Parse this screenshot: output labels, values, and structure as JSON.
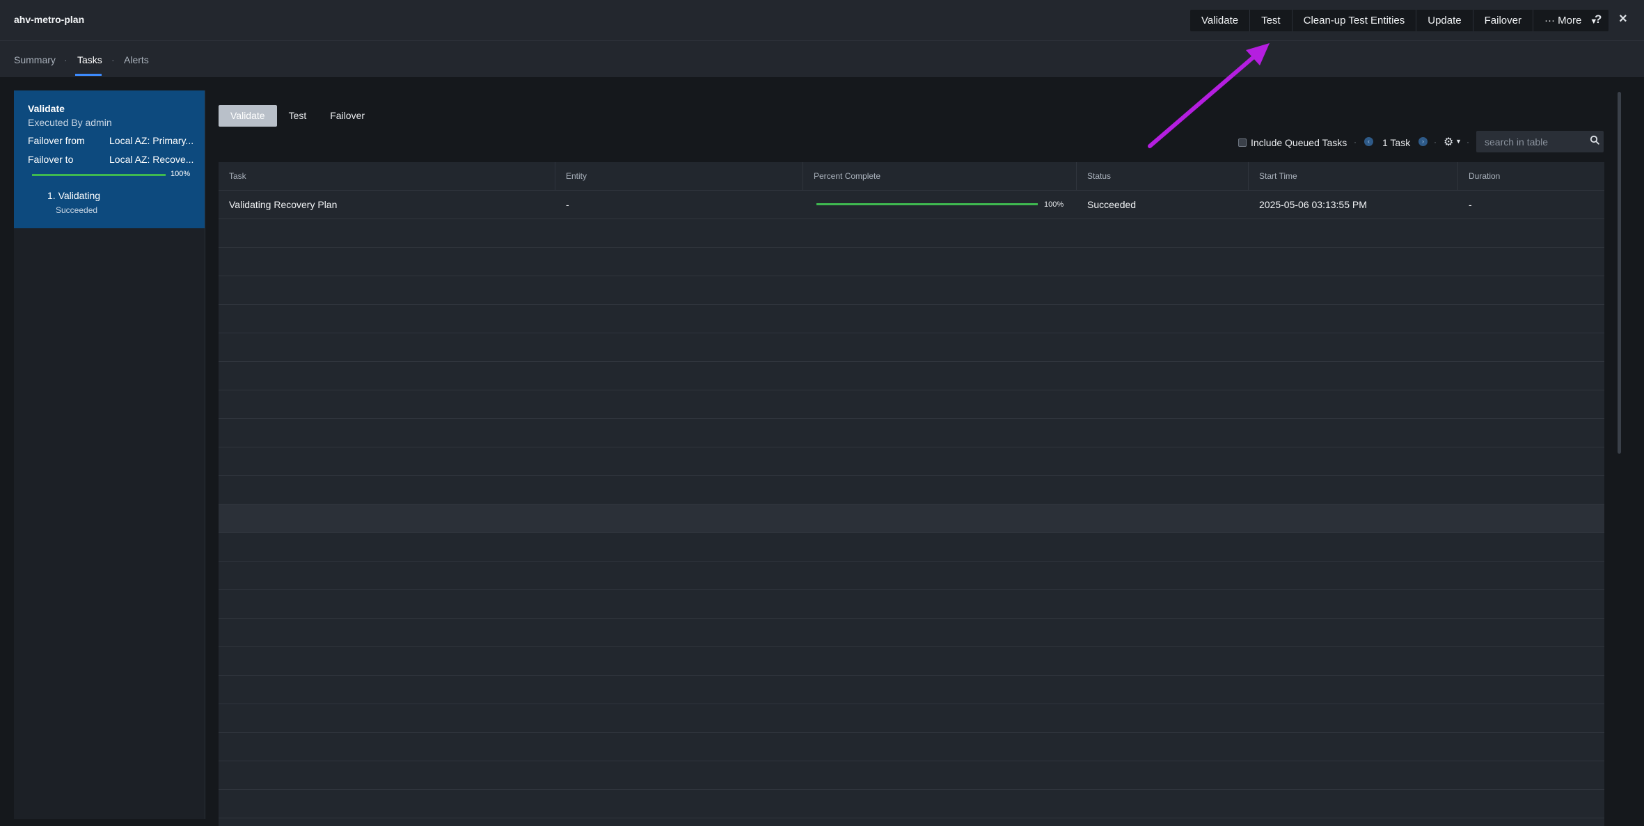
{
  "header": {
    "title": "ahv-metro-plan",
    "actions": [
      "Validate",
      "Test",
      "Clean-up Test Entities",
      "Update",
      "Failover",
      "··· More"
    ],
    "help": "?",
    "close": "×"
  },
  "tabs": [
    {
      "label": "Summary"
    },
    {
      "label": "Tasks",
      "active": true
    },
    {
      "label": "Alerts"
    }
  ],
  "plan": {
    "title": "Validate",
    "executed_by": "Executed By admin",
    "failover_from_label": "Failover from",
    "failover_from_value": "Local AZ: Primary...",
    "failover_to_label": "Failover to",
    "failover_to_value": "Local AZ: Recove...",
    "progress": 1.0,
    "progress_label": "100%",
    "step_label": "1. Validating",
    "step_status": "Succeeded"
  },
  "filters": {
    "tabs": [
      "Validate",
      "Test",
      "Failover"
    ],
    "active": "Validate"
  },
  "toolbar": {
    "include_queued_label": "Include Queued Tasks",
    "count_label": "1 Task",
    "search_placeholder": "search in table"
  },
  "table": {
    "columns": [
      "Task",
      "Entity",
      "Percent Complete",
      "Status",
      "Start Time",
      "Duration"
    ],
    "rows": [
      {
        "task": "Validating Recovery Plan",
        "entity": "-",
        "percent": 1.0,
        "percent_label": "100%",
        "status": "Succeeded",
        "start_time": "2025-05-06 03:13:55 PM",
        "duration": "-"
      }
    ]
  },
  "colors": {
    "accent": "#3d8bfd",
    "plan_card": "#0d4a7e",
    "progress": "#3fb950",
    "annotation_arrow": "#b51ee0"
  }
}
